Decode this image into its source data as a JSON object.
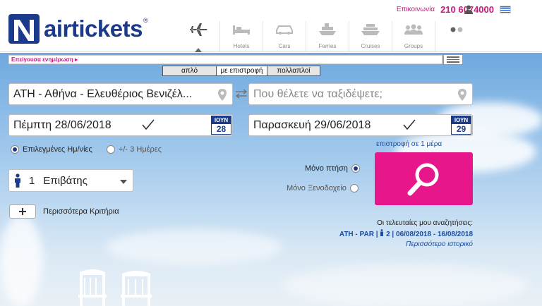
{
  "header": {
    "logo_text": "airtickets",
    "logo_reg": "®",
    "contact_label": "Επικοινωνία",
    "contact_phone": "210 6074000",
    "nav": [
      {
        "label": "",
        "icon": "plane-icon"
      },
      {
        "label": "Hotels",
        "icon": "bed-icon"
      },
      {
        "label": "Cars",
        "icon": "car-icon"
      },
      {
        "label": "Ferries",
        "icon": "ferry-icon"
      },
      {
        "label": "Cruises",
        "icon": "cruise-ship-icon"
      },
      {
        "label": "Groups",
        "icon": "group-icon"
      },
      {
        "label": "",
        "icon": "more-dots-icon"
      }
    ]
  },
  "urgent": {
    "label": "Επείγουσα ενημέρωση ▸"
  },
  "tabs": [
    {
      "label": "απλό",
      "active": false
    },
    {
      "label": "με επιστροφή",
      "active": true
    },
    {
      "label": "πολλαπλοί",
      "active": false
    }
  ],
  "search": {
    "from_value": "ΑΤΗ - Αθήνα - Ελευθέριος Βενιζέλ...",
    "to_placeholder": "Που θέλετε να ταξιδέψετε;",
    "depart_date": "Πέμπτη 28/06/2018",
    "depart_cal": {
      "month": "ΙΟΥΝ",
      "day": "28"
    },
    "return_date": "Παρασκευή 29/06/2018",
    "return_cal": {
      "month": "ΙΟΥΝ",
      "day": "29"
    },
    "return_note": "επιστροφή σε 1 μέρα",
    "date_mode": {
      "selected": "Επιλεγμένες Ημ/νίες",
      "alt": "+/- 3 Ημέρες"
    },
    "passengers_count": "1",
    "passengers_label": "Επιβάτης",
    "flight_only": "Μόνο πτήση",
    "hotel_only": "Μόνο Ξενοδοχείο",
    "more_criteria": "Περισσότερα Κριτήρια"
  },
  "recent": {
    "heading": "Οι τελευταίες μου αναζητήσεις:",
    "route": "ATH - PAR",
    "pax": "2",
    "dates": "06/08/2018 - 16/08/2018",
    "history": "Περισσότερο ιστορικό"
  },
  "colors": {
    "brand": "#1b3a8c",
    "accent": "#e8168b",
    "link": "#1b4ea0"
  }
}
